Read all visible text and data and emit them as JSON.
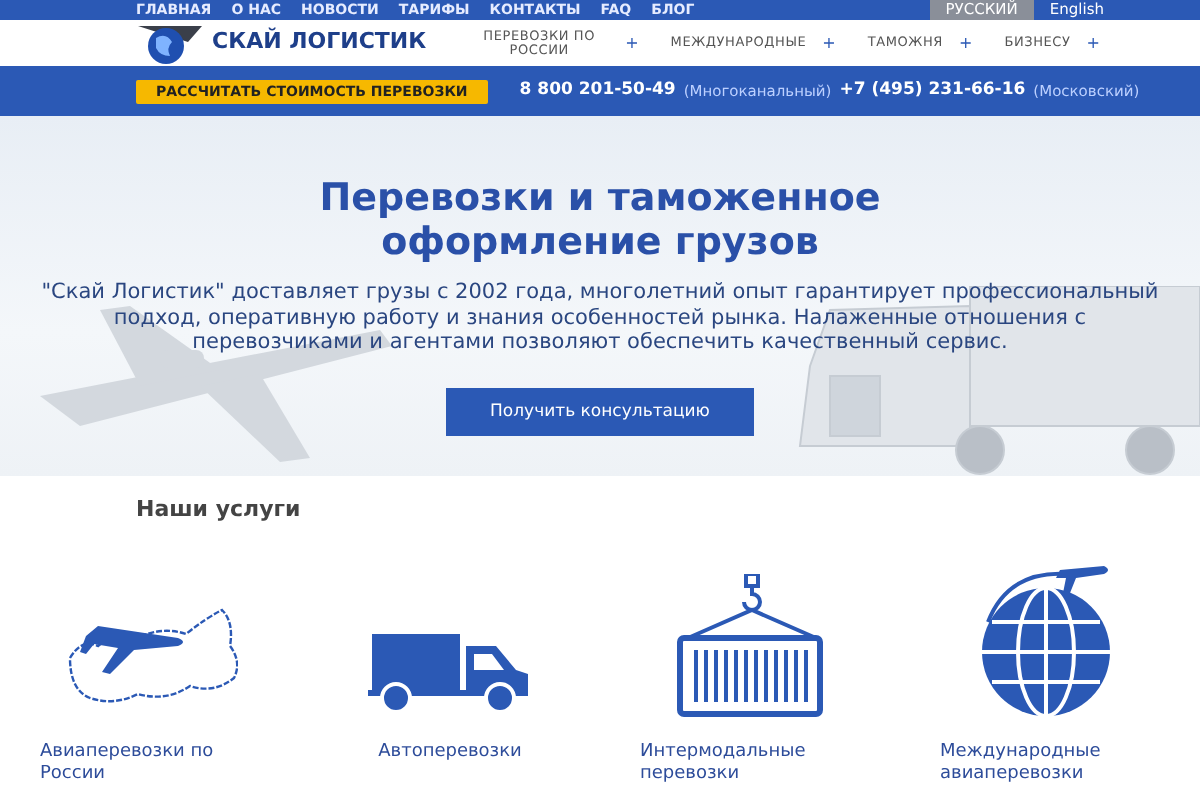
{
  "top_nav": [
    "ГЛАВНАЯ",
    "О НАС",
    "НОВОСТИ",
    "ТАРИФЫ",
    "КОНТАКТЫ",
    "FAQ",
    "БЛОГ"
  ],
  "languages": [
    {
      "label": "РУССКИЙ",
      "selected": true
    },
    {
      "label": "English",
      "selected": false
    }
  ],
  "logo": {
    "text": "СКАЙ ЛОГИСТИК"
  },
  "main_nav": [
    {
      "label": "ПЕРЕВОЗКИ ПО РОССИИ",
      "expander": "+"
    },
    {
      "label": "МЕЖДУНАРОДНЫЕ",
      "expander": "+"
    },
    {
      "label": "ТАМОЖНЯ",
      "expander": "+"
    },
    {
      "label": "БИЗНЕСУ",
      "expander": "+"
    }
  ],
  "calc_button": "РАССЧИТАТЬ СТОИМОСТЬ ПЕРЕВОЗКИ",
  "phones": [
    {
      "number": "8 800 201-50-49",
      "note": "(Многоканальный)"
    },
    {
      "number": "+7 (495) 231-66-16",
      "note": "(Московский)"
    }
  ],
  "hero": {
    "title": "Перевозки и таможенное оформление грузов",
    "text": "\"Скай Логистик\" доставляет грузы с 2002 года, многолетний опыт гарантирует профессиональный подход, оперативную работу и знания особенностей рынка. Налаженные отношения с перевозчиками и агентами позволяют обеспечить качественный сервис.",
    "button": "Получить консультацию"
  },
  "services": {
    "title": "Наши услуги",
    "items": [
      {
        "kind": "map",
        "label": "Авиаперевозки по России"
      },
      {
        "kind": "truck",
        "label": "Автоперевозки"
      },
      {
        "kind": "container",
        "label": "Интермодальные перевозки"
      },
      {
        "kind": "globe",
        "label": "Международные авиаперевозки"
      }
    ]
  }
}
